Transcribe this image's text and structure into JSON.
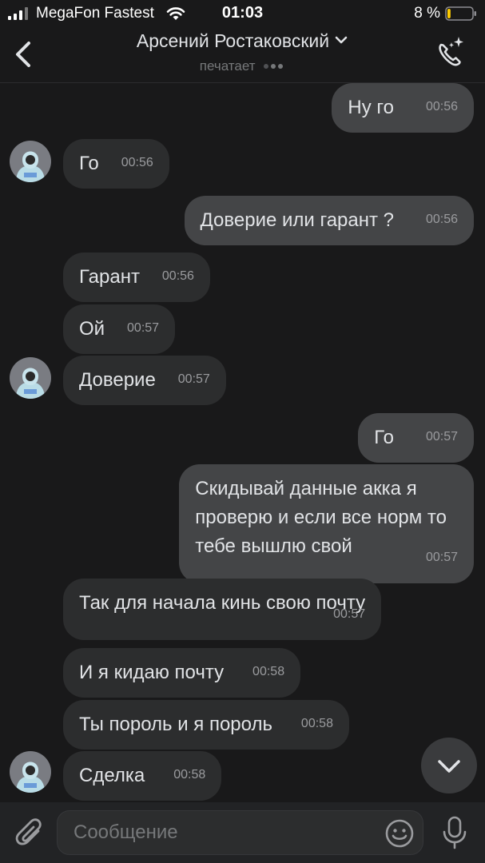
{
  "status_bar": {
    "carrier": "MegaFon Fastest",
    "time": "01:03",
    "battery": "8 %",
    "battery_level": 0.08
  },
  "header": {
    "contact_name": "Арсений Ростаковский",
    "status": "печатает",
    "icons": {
      "back": "chevron-left-icon",
      "expand": "chevron-down-icon",
      "call": "phone-sparkle-icon"
    }
  },
  "messages": [
    {
      "direction": "out",
      "text": "Ну го",
      "time": "00:56"
    },
    {
      "direction": "in",
      "text": "Го",
      "time": "00:56"
    },
    {
      "direction": "out",
      "text": "Доверие или гарант ?",
      "time": "00:56"
    },
    {
      "direction": "in",
      "text": "Гарант",
      "time": "00:56"
    },
    {
      "direction": "in",
      "text": "Ой",
      "time": "00:57"
    },
    {
      "direction": "in",
      "text": "Доверие",
      "time": "00:57"
    },
    {
      "direction": "out",
      "text": "Го",
      "time": "00:57"
    },
    {
      "direction": "out",
      "text": "Скидывай данные акка я\nпроверю и если все норм то\nтебе вышлю свой",
      "time": "00:57"
    },
    {
      "direction": "in",
      "text": "Так для начала кинь свою почту",
      "time": "00:57"
    },
    {
      "direction": "in",
      "text": "И я кидаю почту",
      "time": "00:58"
    },
    {
      "direction": "in",
      "text": "Ты пороль и я пороль",
      "time": "00:58"
    },
    {
      "direction": "in",
      "text": "Сделка",
      "time": "00:58"
    }
  ],
  "composer": {
    "placeholder": "Сообщение",
    "icons": {
      "attach": "paperclip-icon",
      "emoji": "smiley-icon",
      "mic": "microphone-icon",
      "scroll": "chevron-down-icon"
    }
  },
  "colors": {
    "background": "#19191a",
    "incoming_bubble": "#2c2d2e",
    "outgoing_bubble": "#444547",
    "text": "#e1e3e6",
    "secondary_text": "#76787a"
  }
}
